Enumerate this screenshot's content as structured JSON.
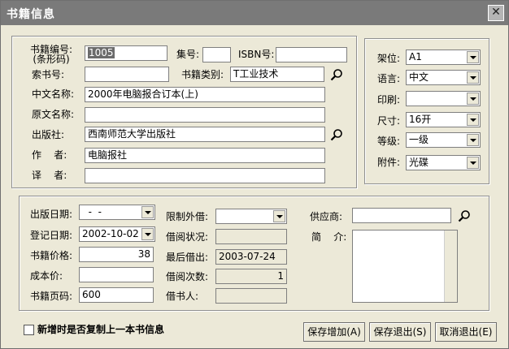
{
  "window": {
    "title": "书籍信息",
    "close_glyph": "✕"
  },
  "left_panel": {
    "book_no_label": "书籍编号:\n(条形码)",
    "book_no_value": "1005",
    "set_no_label": "集号:",
    "set_no_value": "",
    "isbn_label": "ISBN号:",
    "isbn_value": "",
    "call_no_label": "索书号:",
    "call_no_value": "",
    "category_label": "书籍类别:",
    "category_value": "T工业技术",
    "cn_name_label": "中文名称:",
    "cn_name_value": "2000年电脑报合订本(上)",
    "orig_name_label": "原文名称:",
    "orig_name_value": "",
    "publisher_label": "出版社:",
    "publisher_value": "西南师范大学出版社",
    "author_label": "作    者:",
    "author_value": "电脑报社",
    "translator_label": "译    者:",
    "translator_value": ""
  },
  "right_panel": {
    "shelf_label": "架位:",
    "shelf_value": "A1",
    "language_label": "语言:",
    "language_value": "中文",
    "print_label": "印刷:",
    "print_value": "",
    "size_label": "尺寸:",
    "size_value": "16开",
    "grade_label": "等级:",
    "grade_value": "一级",
    "attachment_label": "附件:",
    "attachment_value": "光碟"
  },
  "bottom_panel": {
    "pub_date_label": "出版日期:",
    "pub_date_value": "  -  -",
    "reg_date_label": "登记日期:",
    "reg_date_value": "2002-10-02",
    "price_label": "书籍价格:",
    "price_value": "38",
    "cost_label": "成本价:",
    "cost_value": "",
    "pages_label": "书籍页码:",
    "pages_value": "600",
    "restrict_label": "限制外借:",
    "restrict_value": "",
    "borrow_status_label": "借阅状况:",
    "borrow_status_value": "",
    "last_borrow_label": "最后借出:",
    "last_borrow_value": "2003-07-24",
    "borrow_count_label": "借阅次数:",
    "borrow_count_value": "1",
    "borrower_label": "借书人:",
    "borrower_value": "",
    "supplier_label": "供应商:",
    "supplier_value": "",
    "intro_label": "简    介:"
  },
  "footer": {
    "copy_checkbox_label": "新增时是否复制上一本书信息",
    "save_add_label": "保存增加(A)",
    "save_exit_label": "保存退出(S)",
    "cancel_exit_label": "取消退出(E)"
  }
}
